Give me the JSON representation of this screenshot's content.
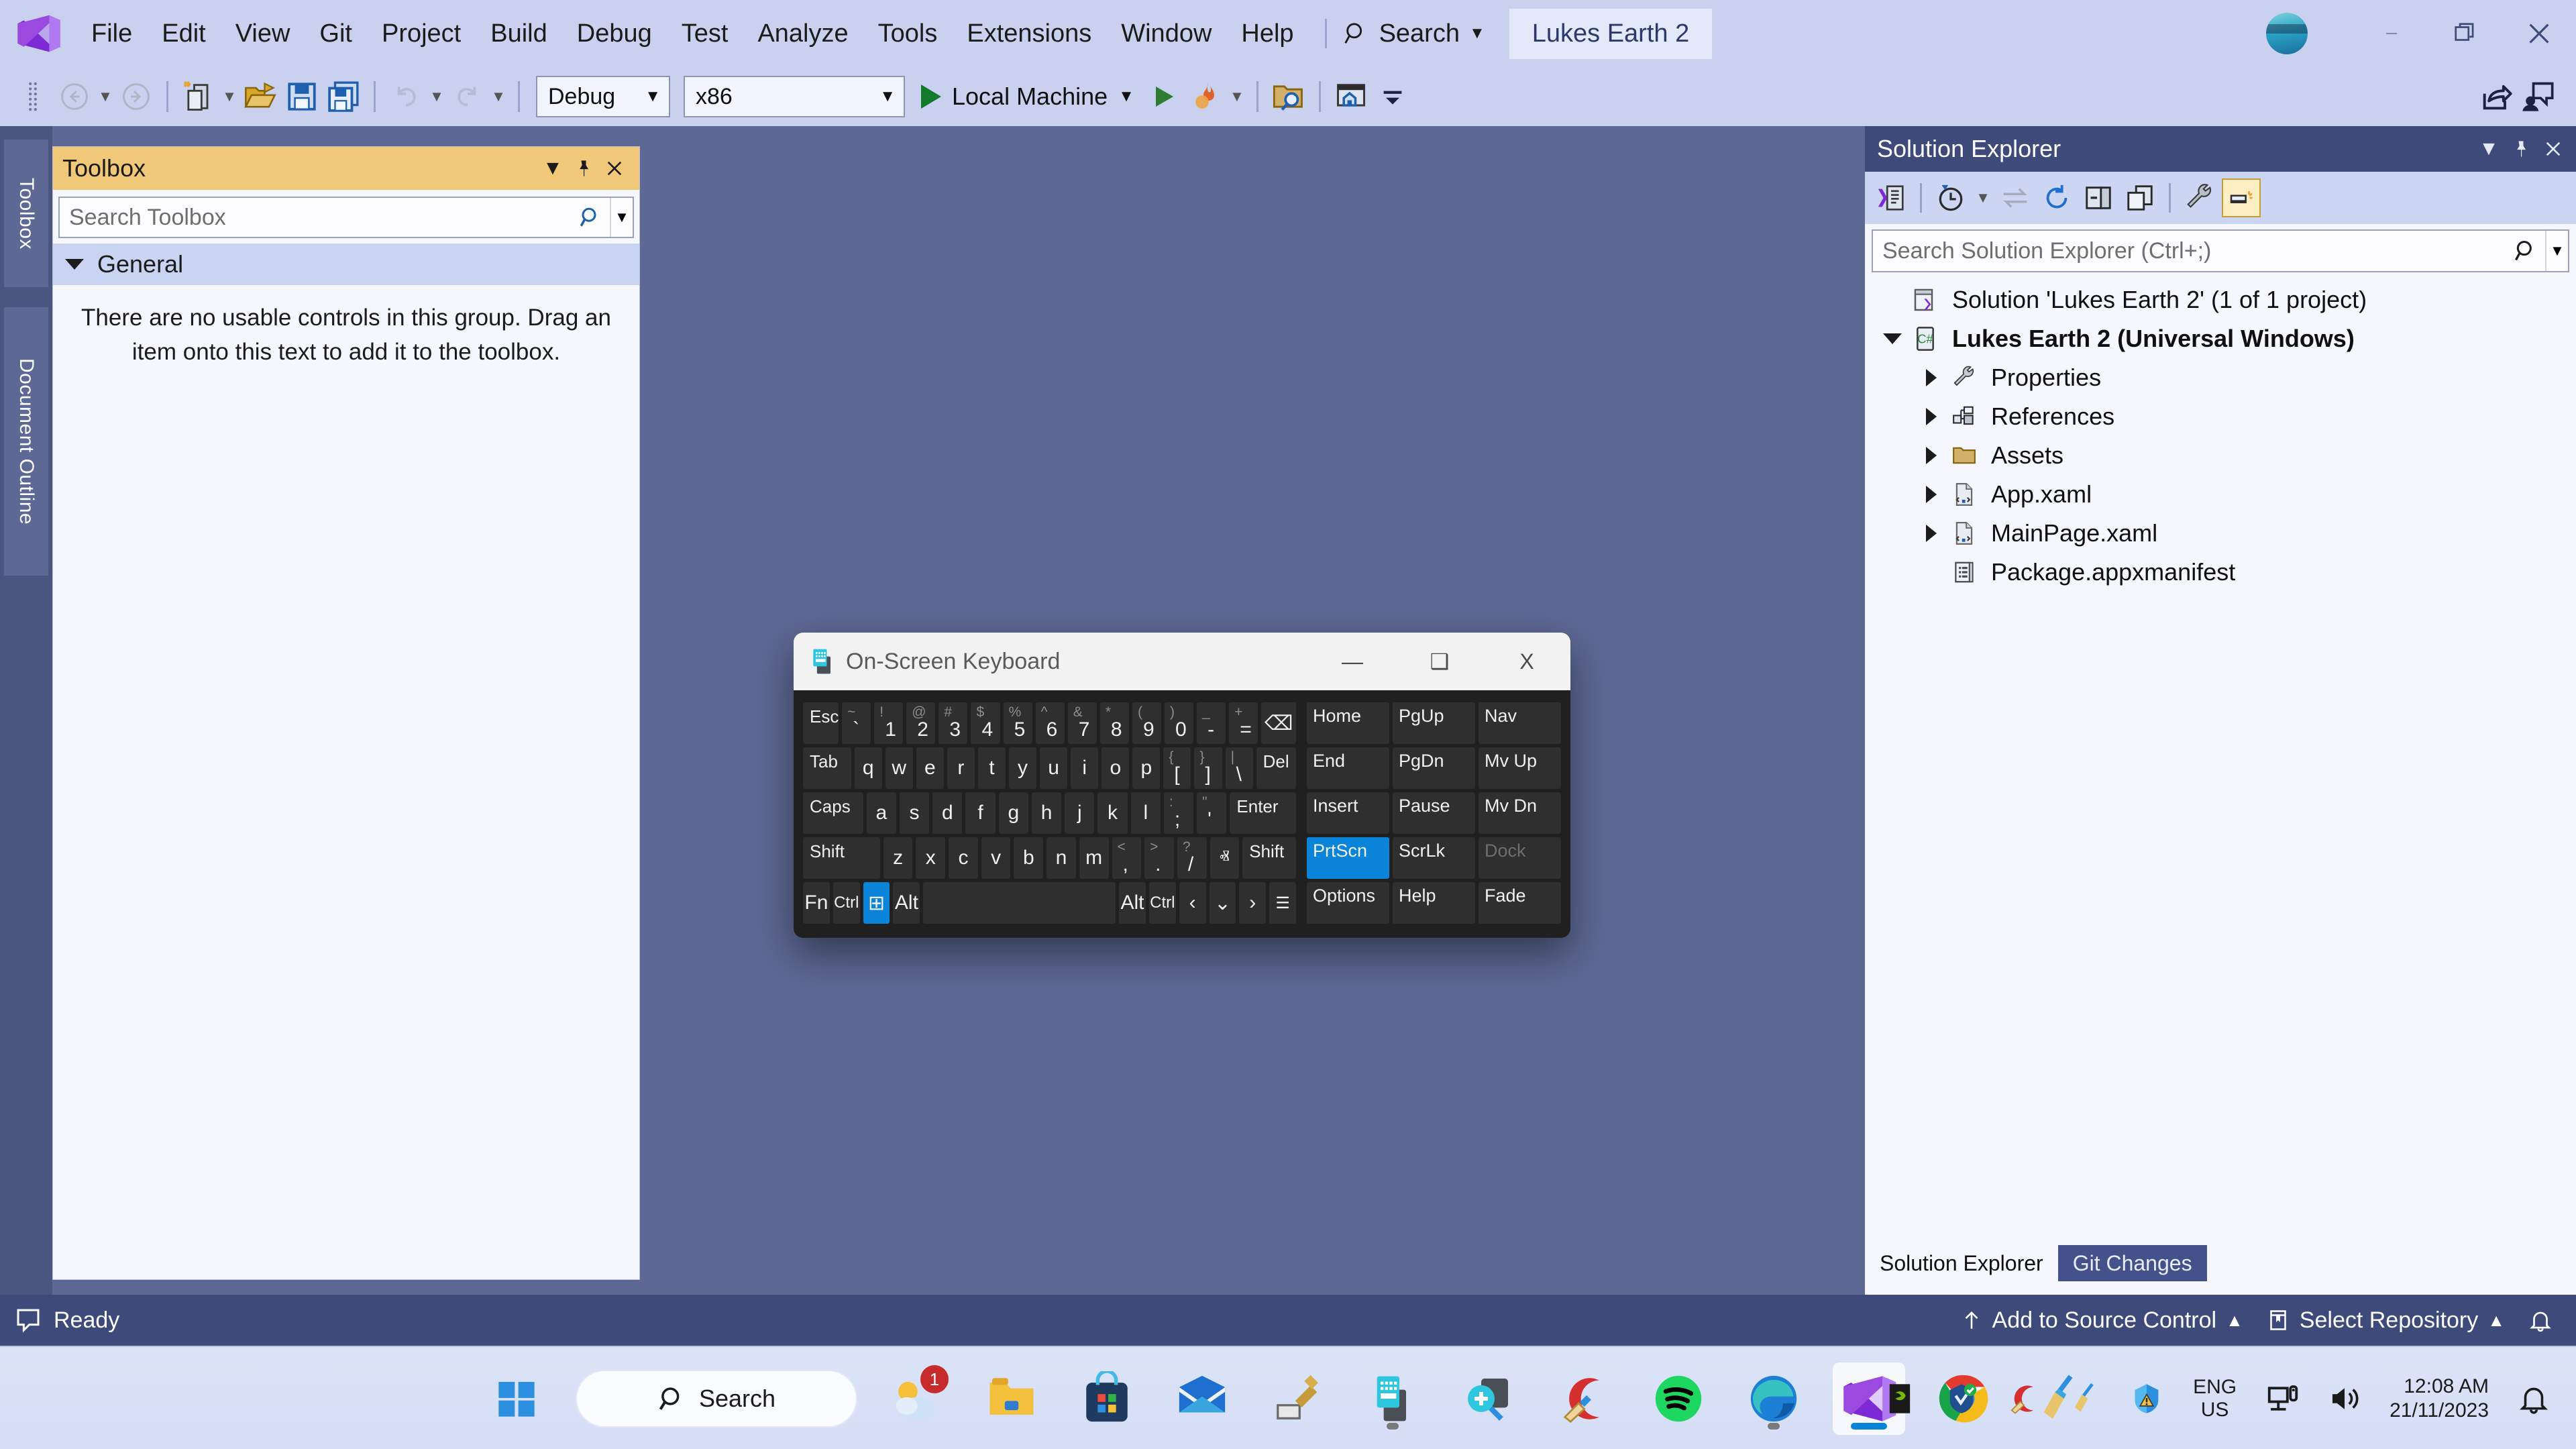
{
  "app": {
    "title": "Lukes Earth 2",
    "menu": [
      "File",
      "Edit",
      "View",
      "Git",
      "Project",
      "Build",
      "Debug",
      "Test",
      "Analyze",
      "Tools",
      "Extensions",
      "Window",
      "Help"
    ],
    "search_label": "Search",
    "accent": "#3d4a7a",
    "chrome_bg": "#c9d1ef"
  },
  "window_controls": {
    "minimize": "—",
    "restore": "❐",
    "close": "✕"
  },
  "toolbar": {
    "configuration": "Debug",
    "platform": "x86",
    "start_label": "Local Machine",
    "icons": [
      "navigate-back-icon",
      "navigate-forward-icon",
      "new-project-icon",
      "open-file-icon",
      "save-icon",
      "save-all-icon",
      "undo-icon",
      "redo-icon",
      "start-debug-icon",
      "hot-reload-icon",
      "find-in-files-icon",
      "home-icon",
      "overflow-icon"
    ]
  },
  "rail": {
    "tabs": [
      "Toolbox",
      "Document Outline"
    ]
  },
  "toolbox": {
    "title": "Toolbox",
    "search_placeholder": "Search Toolbox",
    "search_value": "",
    "group_label": "General",
    "empty_message": "There are no usable controls in this group. Drag an item onto this text to add it to the toolbox.",
    "header_buttons": [
      "window-dropdown-icon",
      "pin-icon",
      "close-icon"
    ]
  },
  "solution_explorer": {
    "title": "Solution Explorer",
    "search_placeholder": "Search Solution Explorer (Ctrl+;)",
    "search_value": "",
    "tools": [
      "code-view-icon",
      "pending-changes-icon",
      "sync-icon",
      "refresh-icon",
      "collapse-all-icon",
      "show-all-files-icon",
      "properties-icon",
      "preview-selected-items-icon"
    ],
    "header_buttons": [
      "window-dropdown-icon",
      "pin-icon",
      "close-icon"
    ],
    "tree": [
      {
        "label": "Solution 'Lukes Earth 2' (1 of 1 project)",
        "icon": "solution-icon",
        "indent": 0,
        "twisty": "none",
        "bold": false
      },
      {
        "label": "Lukes Earth 2 (Universal Windows)",
        "icon": "csharp-project-icon",
        "indent": 1,
        "twisty": "down",
        "bold": true
      },
      {
        "label": "Properties",
        "icon": "wrench-icon",
        "indent": 2,
        "twisty": "right",
        "bold": false
      },
      {
        "label": "References",
        "icon": "references-icon",
        "indent": 2,
        "twisty": "right",
        "bold": false
      },
      {
        "label": "Assets",
        "icon": "folder-icon",
        "indent": 2,
        "twisty": "right",
        "bold": false
      },
      {
        "label": "App.xaml",
        "icon": "xaml-file-icon",
        "indent": 2,
        "twisty": "right",
        "bold": false
      },
      {
        "label": "MainPage.xaml",
        "icon": "xaml-file-icon",
        "indent": 2,
        "twisty": "right",
        "bold": false
      },
      {
        "label": "Package.appxmanifest",
        "icon": "manifest-file-icon",
        "indent": 2,
        "twisty": "none",
        "bold": false
      }
    ],
    "tabs": [
      {
        "label": "Solution Explorer",
        "selected": true
      },
      {
        "label": "Git Changes",
        "selected": false
      }
    ]
  },
  "status_bar": {
    "ready": "Ready",
    "add_to_source_control": "Add to Source Control",
    "select_repository": "Select Repository",
    "caret_up": "▲",
    "icons": [
      "feedback-icon",
      "arrow-up-icon",
      "repository-icon",
      "notifications-icon"
    ]
  },
  "osk": {
    "title": "On-Screen Keyboard",
    "controls": {
      "minimize": "—",
      "maximize": "❑",
      "close": "X"
    },
    "rows": [
      [
        {
          "label": "Esc",
          "type": "label",
          "flex": 1.0
        },
        {
          "upper": "~",
          "lower": "`",
          "type": "dual",
          "flex": 1.0
        },
        {
          "upper": "!",
          "lower": "1",
          "type": "dual",
          "flex": 1.0
        },
        {
          "upper": "@",
          "lower": "2",
          "type": "dual",
          "flex": 1.0
        },
        {
          "upper": "#",
          "lower": "3",
          "type": "dual",
          "flex": 1.0
        },
        {
          "upper": "$",
          "lower": "4",
          "type": "dual",
          "flex": 1.0
        },
        {
          "upper": "%",
          "lower": "5",
          "type": "dual",
          "flex": 1.0
        },
        {
          "upper": "^",
          "lower": "6",
          "type": "dual",
          "flex": 1.0
        },
        {
          "upper": "&",
          "lower": "7",
          "type": "dual",
          "flex": 1.0
        },
        {
          "upper": "*",
          "lower": "8",
          "type": "dual",
          "flex": 1.0
        },
        {
          "upper": "(",
          "lower": "9",
          "type": "dual",
          "flex": 1.0
        },
        {
          "upper": ")",
          "lower": "0",
          "type": "dual",
          "flex": 1.0
        },
        {
          "upper": "_",
          "lower": "-",
          "type": "dual",
          "flex": 1.0
        },
        {
          "upper": "+",
          "lower": "=",
          "type": "dual",
          "flex": 1.0
        },
        {
          "label": "⌫",
          "type": "glyph",
          "flex": 1.2
        }
      ],
      [
        {
          "label": "Tab",
          "type": "label",
          "flex": 1.5
        },
        {
          "label": "q",
          "type": "char",
          "flex": 1.0
        },
        {
          "label": "w",
          "type": "char",
          "flex": 1.0
        },
        {
          "label": "e",
          "type": "char",
          "flex": 1.0
        },
        {
          "label": "r",
          "type": "char",
          "flex": 1.0
        },
        {
          "label": "t",
          "type": "char",
          "flex": 1.0
        },
        {
          "label": "y",
          "type": "char",
          "flex": 1.0
        },
        {
          "label": "u",
          "type": "char",
          "flex": 1.0
        },
        {
          "label": "i",
          "type": "char",
          "flex": 1.0
        },
        {
          "label": "o",
          "type": "char",
          "flex": 1.0
        },
        {
          "label": "p",
          "type": "char",
          "flex": 1.0
        },
        {
          "upper": "{",
          "lower": "[",
          "type": "dual",
          "flex": 1.0
        },
        {
          "upper": "}",
          "lower": "]",
          "type": "dual",
          "flex": 1.0
        },
        {
          "upper": "|",
          "lower": "\\",
          "type": "dual",
          "flex": 1.0
        },
        {
          "label": "Del",
          "type": "label",
          "flex": 1.2
        }
      ],
      [
        {
          "label": "Caps",
          "type": "label",
          "flex": 1.8
        },
        {
          "label": "a",
          "type": "char",
          "flex": 1.0
        },
        {
          "label": "s",
          "type": "char",
          "flex": 1.0
        },
        {
          "label": "d",
          "type": "char",
          "flex": 1.0
        },
        {
          "label": "f",
          "type": "char",
          "flex": 1.0
        },
        {
          "label": "g",
          "type": "char",
          "flex": 1.0
        },
        {
          "label": "h",
          "type": "char",
          "flex": 1.0
        },
        {
          "label": "j",
          "type": "char",
          "flex": 1.0
        },
        {
          "label": "k",
          "type": "char",
          "flex": 1.0
        },
        {
          "label": "l",
          "type": "char",
          "flex": 1.0
        },
        {
          "upper": ":",
          "lower": ";",
          "type": "dual",
          "flex": 1.0
        },
        {
          "upper": "\"",
          "lower": "'",
          "type": "dual",
          "flex": 1.0
        },
        {
          "label": "Enter",
          "type": "label",
          "flex": 2.0
        }
      ],
      [
        {
          "label": "Shift",
          "type": "label",
          "flex": 2.4
        },
        {
          "label": "z",
          "type": "char",
          "flex": 1.0
        },
        {
          "label": "x",
          "type": "char",
          "flex": 1.0
        },
        {
          "label": "c",
          "type": "char",
          "flex": 1.0
        },
        {
          "label": "v",
          "type": "char",
          "flex": 1.0
        },
        {
          "label": "b",
          "type": "char",
          "flex": 1.0
        },
        {
          "label": "n",
          "type": "char",
          "flex": 1.0
        },
        {
          "label": "m",
          "type": "char",
          "flex": 1.0
        },
        {
          "upper": "<",
          "lower": ",",
          "type": "dual",
          "flex": 1.0
        },
        {
          "upper": ">",
          "lower": ".",
          "type": "dual",
          "flex": 1.0
        },
        {
          "upper": "?",
          "lower": "/",
          "type": "dual",
          "flex": 1.0
        },
        {
          "label": "ⱏ",
          "type": "glyph",
          "flex": 1.0
        },
        {
          "label": "Shift",
          "type": "label",
          "flex": 1.6
        }
      ],
      [
        {
          "label": "Fn",
          "type": "char",
          "flex": 1.0
        },
        {
          "label": "Ctrl",
          "type": "char",
          "flex": 1.0,
          "small": true
        },
        {
          "label": "⊞",
          "type": "glyph",
          "flex": 1.0,
          "highlight": true
        },
        {
          "label": "Alt",
          "type": "char",
          "flex": 1.0
        },
        {
          "label": "",
          "type": "space",
          "flex": 7.2
        },
        {
          "label": "Alt",
          "type": "char",
          "flex": 1.0
        },
        {
          "label": "Ctrl",
          "type": "char",
          "flex": 1.0,
          "small": true
        },
        {
          "label": "‹",
          "type": "glyph",
          "flex": 1.0
        },
        {
          "label": "⌄",
          "type": "glyph",
          "flex": 1.0
        },
        {
          "label": "›",
          "type": "glyph",
          "flex": 1.0
        },
        {
          "label": "☰",
          "type": "glyph",
          "flex": 1.0,
          "small": true
        }
      ]
    ],
    "nav_rows": [
      [
        {
          "label": "Home"
        },
        {
          "label": "PgUp"
        },
        {
          "label": "Nav"
        }
      ],
      [
        {
          "label": "End"
        },
        {
          "label": "PgDn"
        },
        {
          "label": "Mv Up"
        }
      ],
      [
        {
          "label": "Insert"
        },
        {
          "label": "Pause"
        },
        {
          "label": "Mv Dn"
        }
      ],
      [
        {
          "label": "PrtScn",
          "highlight": true
        },
        {
          "label": "ScrLk"
        },
        {
          "label": "Dock",
          "dim": true
        }
      ],
      [
        {
          "label": "Options"
        },
        {
          "label": "Help"
        },
        {
          "label": "Fade"
        }
      ]
    ]
  },
  "taskbar": {
    "search_label": "Search",
    "items": [
      {
        "name": "start-button",
        "icon": "windows-logo-icon"
      },
      {
        "name": "taskbar-search",
        "icon": "search-pill"
      },
      {
        "name": "weather-widget",
        "icon": "weather-icon",
        "badge": "1"
      },
      {
        "name": "file-explorer",
        "icon": "folder-icon"
      },
      {
        "name": "microsoft-store",
        "icon": "store-icon"
      },
      {
        "name": "mail",
        "icon": "mail-icon"
      },
      {
        "name": "tweaking-tool",
        "icon": "hammer-icon"
      },
      {
        "name": "on-screen-keyboard",
        "icon": "keyboard-icon",
        "running": true
      },
      {
        "name": "magnifier",
        "icon": "magnifier-icon"
      },
      {
        "name": "ccleaner",
        "icon": "ccleaner-icon"
      },
      {
        "name": "spotify",
        "icon": "spotify-icon"
      },
      {
        "name": "microsoft-edge",
        "icon": "edge-icon",
        "running": true
      },
      {
        "name": "visual-studio",
        "icon": "visual-studio-icon",
        "active": true
      },
      {
        "name": "google-chrome",
        "icon": "chrome-icon"
      },
      {
        "name": "broom-cleaner",
        "icon": "broom-icon"
      }
    ],
    "tray": [
      {
        "name": "nvidia-tray-icon"
      },
      {
        "name": "system-check-tray-icon"
      },
      {
        "name": "ccleaner-tray-icon"
      },
      {
        "name": "broom-tray-icon"
      },
      {
        "name": "windows-security-warning-icon"
      }
    ],
    "language": {
      "line1": "ENG",
      "line2": "US"
    },
    "network_icon": "network-icon",
    "volume_icon": "volume-icon",
    "clock": {
      "time": "12:08 AM",
      "date": "21/11/2023"
    },
    "notification_icon": "bell-icon"
  }
}
